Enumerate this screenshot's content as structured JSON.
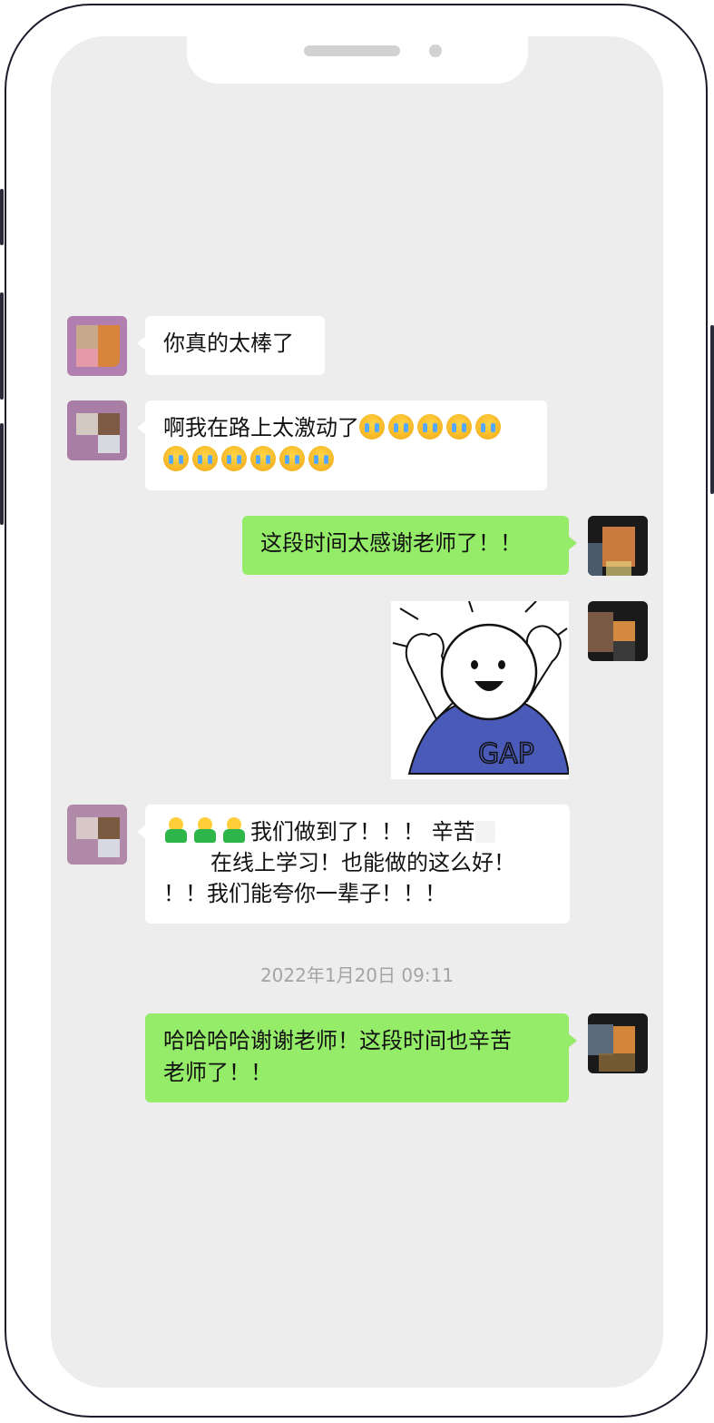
{
  "messages": [
    {
      "side": "in",
      "text": "你真的太棒了"
    },
    {
      "side": "in",
      "text_line1": "啊我在路上太激动了",
      "emoji_row1_count": 5,
      "emoji_row2_count": 6,
      "emoji_name": "loudly-crying-face"
    },
    {
      "side": "out",
      "text": "这段时间太感谢老师了！！"
    },
    {
      "side": "out",
      "type": "sticker",
      "sticker_text": "GAP"
    },
    {
      "side": "in",
      "line1": "我们做到了！！！ 辛苦",
      "line2": "在线上学习！也能做的这么好！",
      "line3": "！！我们能夸你一辈子！！！",
      "emoji_name": "hugging-person"
    },
    {
      "side": "out",
      "line1": "哈哈哈哈谢谢老师！这段时间也辛苦",
      "line2": "老师了！！"
    }
  ],
  "timestamp": "2022年1月20日 09:11",
  "colors": {
    "out_bubble": "#95ec69",
    "in_bubble": "#ffffff",
    "chat_bg": "#ededed"
  }
}
